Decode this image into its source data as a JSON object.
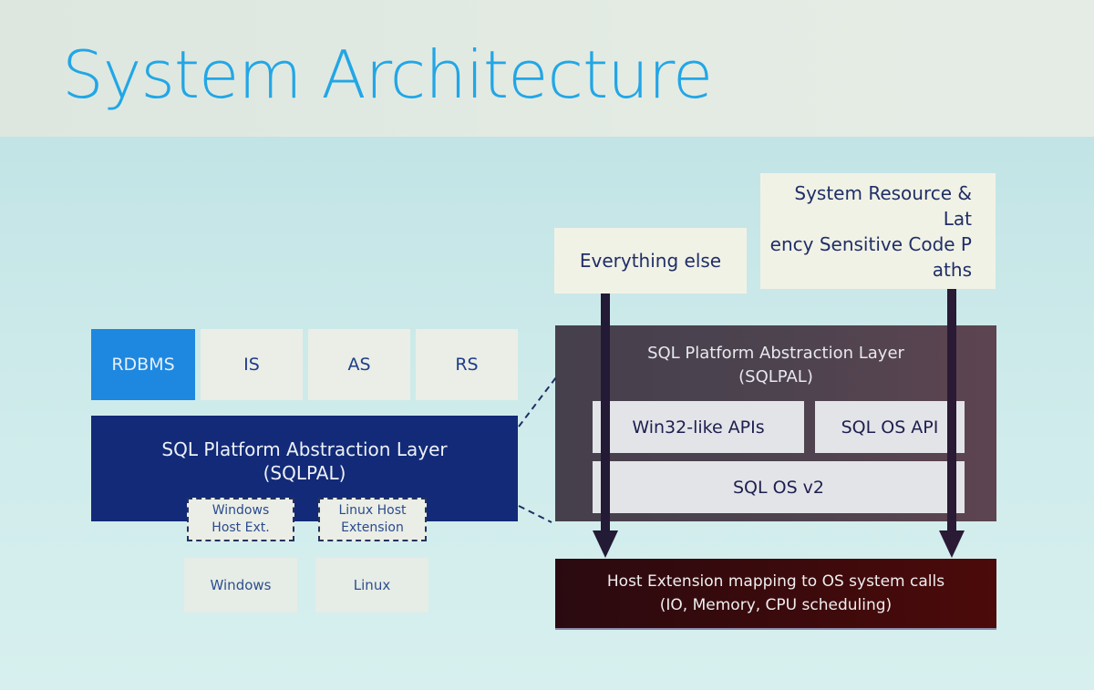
{
  "slide": {
    "title": "System Architecture"
  },
  "left_stack": {
    "services": [
      {
        "label": "RDBMS",
        "active": true
      },
      {
        "label": "IS",
        "active": false
      },
      {
        "label": "AS",
        "active": false
      },
      {
        "label": "RS",
        "active": false
      }
    ],
    "pal": {
      "title_line1": "SQL Platform Abstraction Layer",
      "title_line2": "(SQLPAL)"
    },
    "host_extensions": [
      {
        "line1": "Windows",
        "line2": "Host Ext."
      },
      {
        "line1": "Linux Host",
        "line2": "Extension"
      }
    ],
    "operating_systems": [
      "Windows",
      "Linux"
    ]
  },
  "right_detail": {
    "notes": {
      "everything_else": "Everything else",
      "sensitive_line1": "System Resource & Lat",
      "sensitive_line2": "ency Sensitive Code P",
      "sensitive_line3": "aths"
    },
    "pal": {
      "title_line1": "SQL Platform Abstraction Layer",
      "title_line2": "(SQLPAL)",
      "win32_api": "Win32-like APIs",
      "sqlos_api": "SQL OS API",
      "sqlos_v2": "SQL OS v2"
    },
    "host_mapping": {
      "line1": "Host Extension mapping to OS system calls",
      "line2": "(IO, Memory, CPU scheduling)"
    }
  },
  "colors": {
    "title": "#22a6e6",
    "rdbms_active": "#1e88e0",
    "pal_left": "#122a78",
    "pal_right": "#4c434f",
    "host_mapping": "#3a0a0c",
    "arrow": "#231a35"
  }
}
